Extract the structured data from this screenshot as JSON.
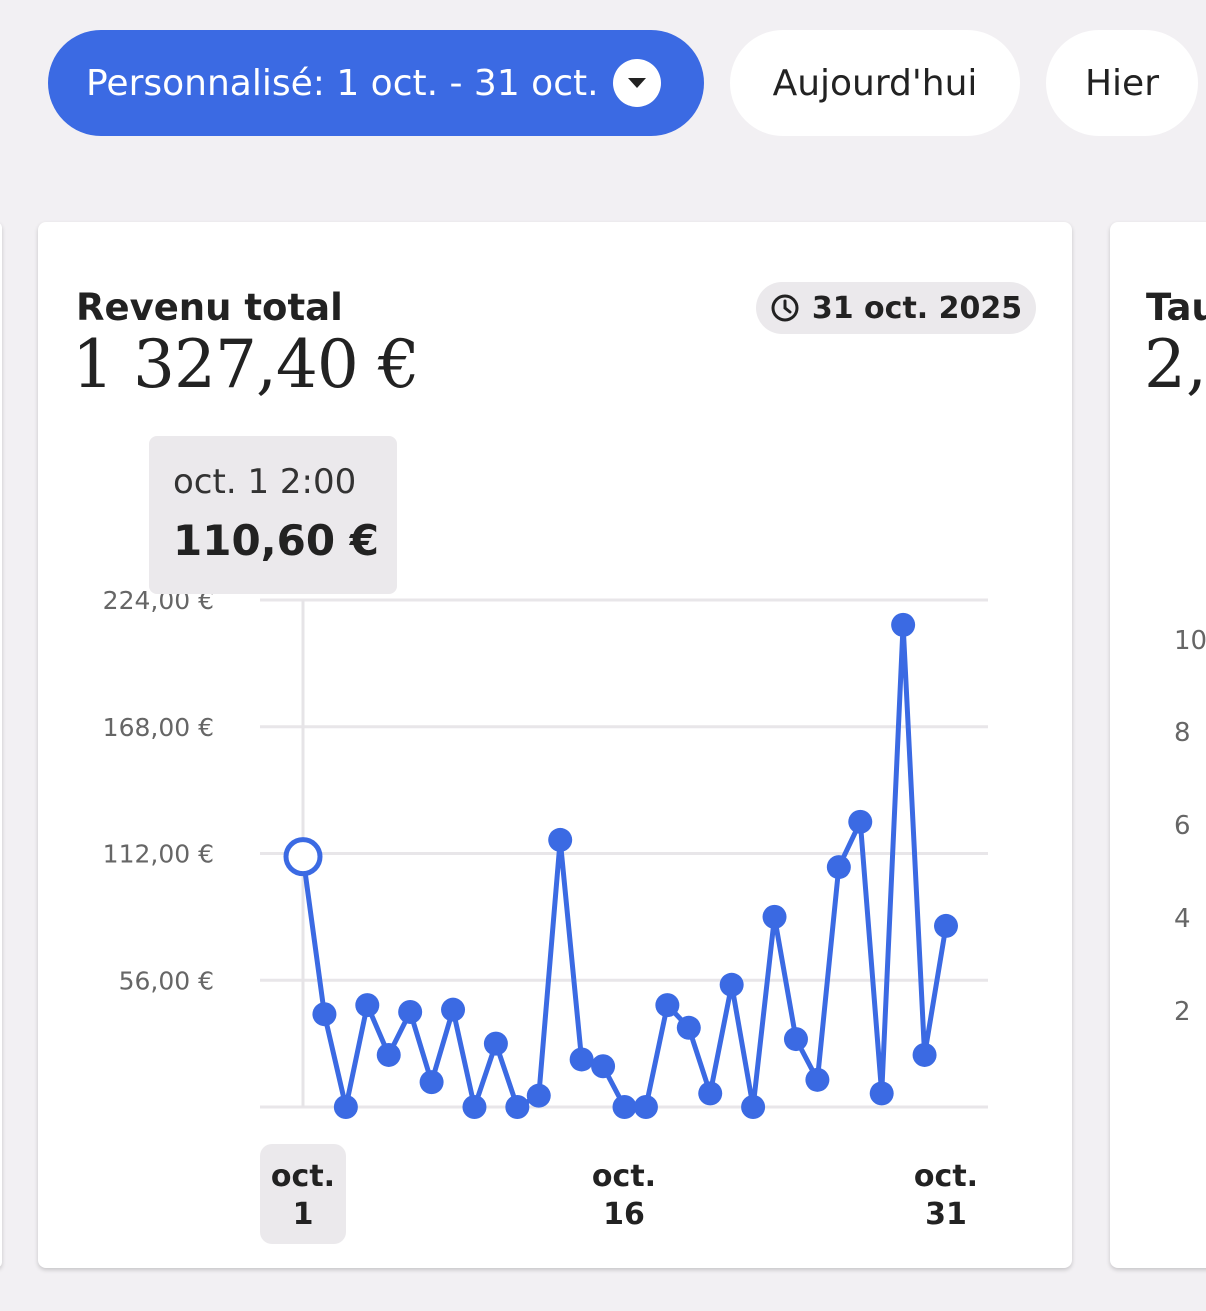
{
  "filters": {
    "range_label": "Personnalisé: 1 oct. - 31 oct.",
    "today_label": "Aujourd'hui",
    "yesterday_label": "Hier"
  },
  "revenue_card": {
    "title": "Revenu total",
    "value": "1 327,40 €",
    "date_badge": "31 oct. 2025",
    "tooltip": {
      "label": "oct. 1 2:00",
      "value": "110,60 €"
    },
    "x_labels": [
      {
        "line1": "oct.",
        "line2": "1"
      },
      {
        "line1": "oct.",
        "line2": "16"
      },
      {
        "line1": "oct.",
        "line2": "31"
      }
    ]
  },
  "next_card": {
    "title": "Tau",
    "value": "2,",
    "y_ticks": [
      "10",
      "8",
      "6",
      "4",
      "2"
    ]
  },
  "colors": {
    "accent": "#3b6ae3",
    "page_bg": "#f2f0f3",
    "card_bg": "#ffffff",
    "chip_bg": "#ebe9ec",
    "grid": "#e8e6e9"
  },
  "chart_data": {
    "type": "line",
    "title": "Revenu total",
    "xlabel": "",
    "ylabel": "",
    "y_ticks": [
      "224,00 €",
      "168,00 €",
      "112,00 €",
      "56,00 €"
    ],
    "ylim": [
      0,
      224
    ],
    "x": [
      "2025-10-01",
      "2025-10-02",
      "2025-10-03",
      "2025-10-04",
      "2025-10-05",
      "2025-10-06",
      "2025-10-07",
      "2025-10-08",
      "2025-10-09",
      "2025-10-10",
      "2025-10-11",
      "2025-10-12",
      "2025-10-13",
      "2025-10-14",
      "2025-10-15",
      "2025-10-16",
      "2025-10-17",
      "2025-10-18",
      "2025-10-19",
      "2025-10-20",
      "2025-10-21",
      "2025-10-22",
      "2025-10-23",
      "2025-10-24",
      "2025-10-25",
      "2025-10-26",
      "2025-10-27",
      "2025-10-28",
      "2025-10-29",
      "2025-10-30",
      "2025-10-31"
    ],
    "x_ticks": [
      "2025-10-01",
      "2025-10-16",
      "2025-10-31"
    ],
    "series": [
      {
        "values": [
          110.6,
          41,
          0,
          45,
          23,
          42,
          11,
          43,
          0,
          28,
          0,
          5,
          118,
          21,
          18,
          0,
          0,
          45,
          35,
          6,
          54,
          0,
          84,
          30,
          12,
          106,
          126,
          6,
          213,
          23,
          80
        ],
        "selected_index": 0
      }
    ],
    "grid": true,
    "legend": "none"
  }
}
